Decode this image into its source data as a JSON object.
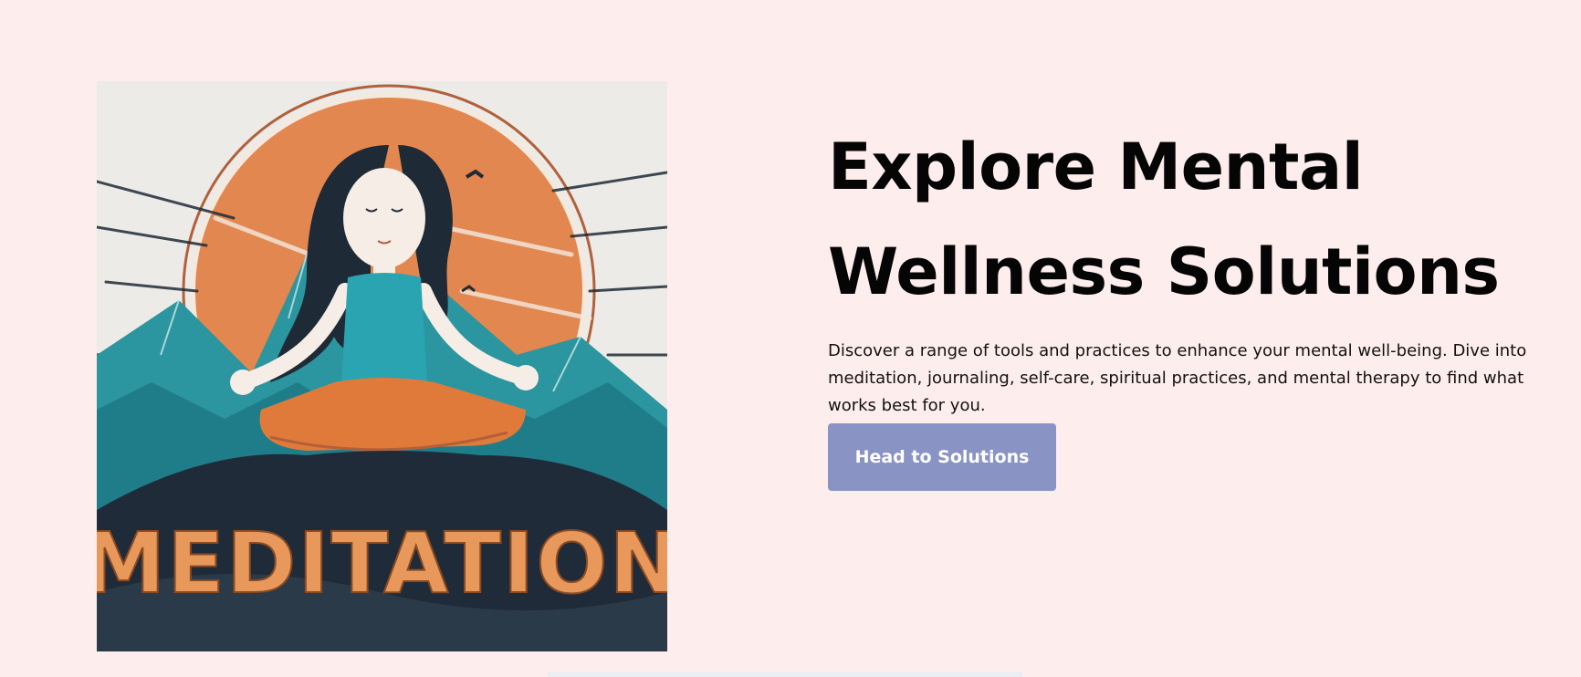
{
  "hero": {
    "image": {
      "alt": "Meditation illustration",
      "caption_text": "MEDITATION",
      "colors": {
        "background": "#ecebe7",
        "sun": "#e2874f",
        "mountains": "#2b95a0",
        "shirt": "#2aa4b0",
        "pants": "#e07a3a",
        "hair": "#1e2a36",
        "rock": "#1f2b38"
      }
    },
    "title": "Explore Mental Wellness Solutions",
    "description": "Discover a range of tools and practices to enhance your mental well-being. Dive into meditation, journaling, self-care, spiritual practices, and mental therapy to find what works best for you.",
    "cta_label": "Head to Solutions"
  },
  "colors": {
    "page_background": "#fdeeed",
    "button_background": "#8a94c4",
    "button_text": "#ffffff"
  }
}
